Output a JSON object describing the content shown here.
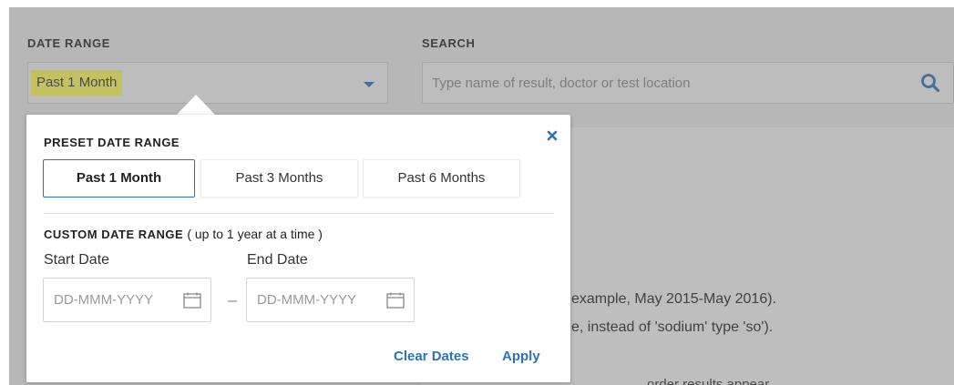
{
  "filters": {
    "date_range_label": "DATE RANGE",
    "date_range_value": "Past 1 Month",
    "search_label": "SEARCH",
    "search_placeholder": "Type name of result, doctor or test location"
  },
  "background_hints": [
    "example, May 2015-May 2016).",
    "e, instead of 'sodium' type 'so').",
    "order results appear."
  ],
  "popover": {
    "preset_heading": "PRESET DATE RANGE",
    "presets": [
      {
        "label": "Past 1 Month",
        "selected": true
      },
      {
        "label": "Past 3 Months",
        "selected": false
      },
      {
        "label": "Past 6 Months",
        "selected": false
      }
    ],
    "custom_heading": "CUSTOM DATE RANGE",
    "custom_note": "( up to 1 year at a time )",
    "start_label": "Start Date",
    "end_label": "End Date",
    "start_placeholder": "DD-MMM-YYYY",
    "end_placeholder": "DD-MMM-YYYY",
    "clear_label": "Clear Dates",
    "apply_label": "Apply"
  },
  "icons": {
    "close": "close-icon",
    "search": "search-icon",
    "calendar": "calendar-icon",
    "dropdown": "chevron-down-icon"
  },
  "colors": {
    "accent": "#2b73b9",
    "highlight": "#ffff57"
  }
}
